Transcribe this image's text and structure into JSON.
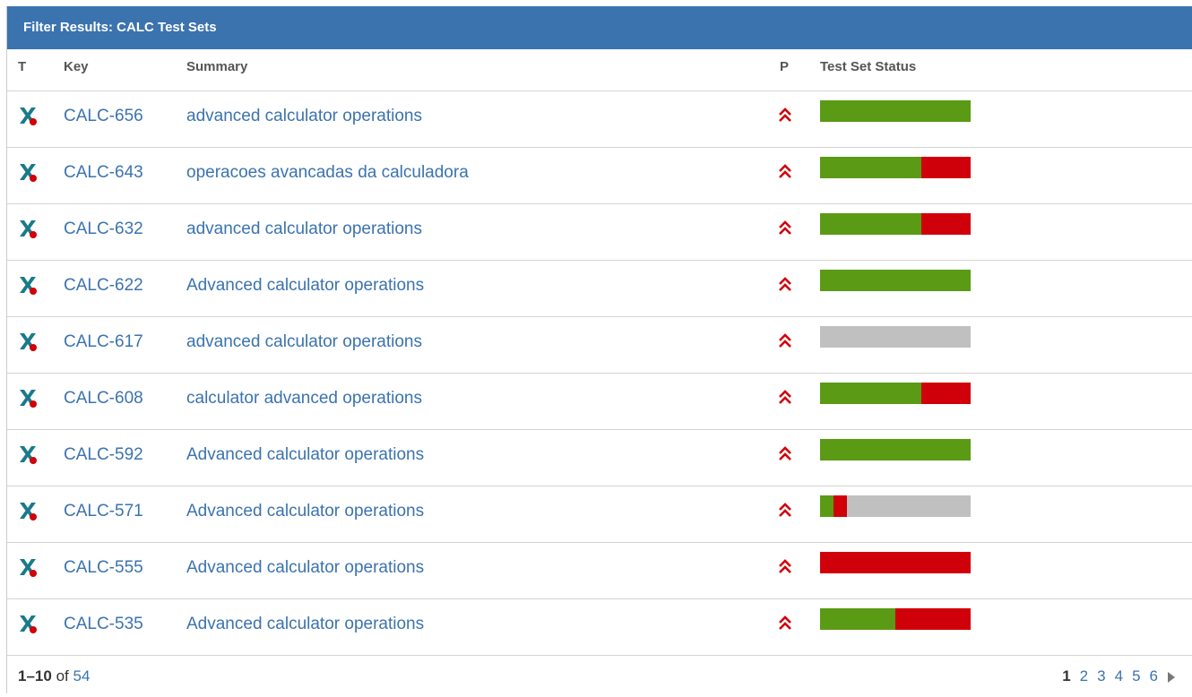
{
  "header": {
    "title": "Filter Results: CALC Test Sets"
  },
  "columns": {
    "type": "T",
    "key": "Key",
    "summary": "Summary",
    "priority": "P",
    "status": "Test Set Status"
  },
  "colors": {
    "pass": "#5a9a14",
    "fail": "#d0000a",
    "todo": "#c0c0c0",
    "header": "#3b73af",
    "link": "#3b73af"
  },
  "rows": [
    {
      "key": "CALC-656",
      "summary": "advanced calculator operations",
      "type_icon": "test-set-icon",
      "priority_icon": "highest-priority-icon",
      "status": {
        "pass": 1.0,
        "fail": 0.0,
        "todo": 0.0
      }
    },
    {
      "key": "CALC-643",
      "summary": "operacoes avancadas da calculadora",
      "type_icon": "test-set-icon",
      "priority_icon": "highest-priority-icon",
      "status": {
        "pass": 0.67,
        "fail": 0.33,
        "todo": 0.0
      }
    },
    {
      "key": "CALC-632",
      "summary": "advanced calculator operations",
      "type_icon": "test-set-icon",
      "priority_icon": "highest-priority-icon",
      "status": {
        "pass": 0.67,
        "fail": 0.33,
        "todo": 0.0
      }
    },
    {
      "key": "CALC-622",
      "summary": "Advanced calculator operations",
      "type_icon": "test-set-icon",
      "priority_icon": "highest-priority-icon",
      "status": {
        "pass": 1.0,
        "fail": 0.0,
        "todo": 0.0
      }
    },
    {
      "key": "CALC-617",
      "summary": "advanced calculator operations",
      "type_icon": "test-set-icon",
      "priority_icon": "highest-priority-icon",
      "status": {
        "pass": 0.0,
        "fail": 0.0,
        "todo": 1.0
      }
    },
    {
      "key": "CALC-608",
      "summary": "calculator advanced operations",
      "type_icon": "test-set-icon",
      "priority_icon": "highest-priority-icon",
      "status": {
        "pass": 0.67,
        "fail": 0.33,
        "todo": 0.0
      }
    },
    {
      "key": "CALC-592",
      "summary": "Advanced calculator operations",
      "type_icon": "test-set-icon",
      "priority_icon": "highest-priority-icon",
      "status": {
        "pass": 1.0,
        "fail": 0.0,
        "todo": 0.0
      }
    },
    {
      "key": "CALC-571",
      "summary": "Advanced calculator operations",
      "type_icon": "test-set-icon",
      "priority_icon": "highest-priority-icon",
      "status": {
        "pass": 0.09,
        "fail": 0.09,
        "todo": 0.82
      }
    },
    {
      "key": "CALC-555",
      "summary": "Advanced calculator operations",
      "type_icon": "test-set-icon",
      "priority_icon": "highest-priority-icon",
      "status": {
        "pass": 0.0,
        "fail": 1.0,
        "todo": 0.0
      }
    },
    {
      "key": "CALC-535",
      "summary": "Advanced calculator operations",
      "type_icon": "test-set-icon",
      "priority_icon": "highest-priority-icon",
      "status": {
        "pass": 0.5,
        "fail": 0.5,
        "todo": 0.0
      }
    }
  ],
  "footer": {
    "range": "1–10",
    "of_label": "of",
    "total": "54",
    "pages": [
      "1",
      "2",
      "3",
      "4",
      "5",
      "6"
    ],
    "current_page": "1",
    "next_icon": "next-page-icon"
  }
}
